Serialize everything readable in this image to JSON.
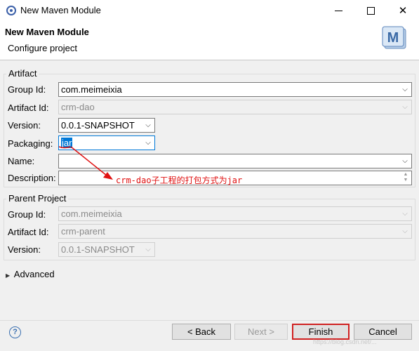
{
  "window": {
    "title": "New Maven Module",
    "controls": {
      "minimize": "minimize-icon",
      "maximize": "maximize-icon",
      "close": "close-icon"
    }
  },
  "header": {
    "title": "New Maven Module",
    "subtitle": "Configure project",
    "icon_letter": "M"
  },
  "artifact": {
    "legend": "Artifact",
    "group_id": {
      "label": "Group Id:",
      "value": "com.meimeixia"
    },
    "artifact_id": {
      "label": "Artifact Id:",
      "value": "crm-dao"
    },
    "version": {
      "label": "Version:",
      "value": "0.0.1-SNAPSHOT"
    },
    "packaging": {
      "label": "Packaging:",
      "value": "jar"
    },
    "name": {
      "label": "Name:",
      "value": ""
    },
    "description": {
      "label": "Description:",
      "value": ""
    }
  },
  "annotation": {
    "text": "crm-dao子工程的打包方式为jar",
    "color": "#e01010"
  },
  "parent": {
    "legend": "Parent Project",
    "group_id": {
      "label": "Group Id:",
      "value": "com.meimeixia"
    },
    "artifact_id": {
      "label": "Artifact Id:",
      "value": "crm-parent"
    },
    "version": {
      "label": "Version:",
      "value": "0.0.1-SNAPSHOT"
    }
  },
  "advanced": {
    "label": "Advanced"
  },
  "footer": {
    "help_icon": "help-icon",
    "back": "< Back",
    "next": "Next >",
    "finish": "Finish",
    "cancel": "Cancel",
    "watermark": "https://blog.csdn.net/..."
  },
  "colors": {
    "selection": "#0078d7",
    "highlight_border": "#d02020",
    "dialog_bg": "#f0f0f0"
  }
}
